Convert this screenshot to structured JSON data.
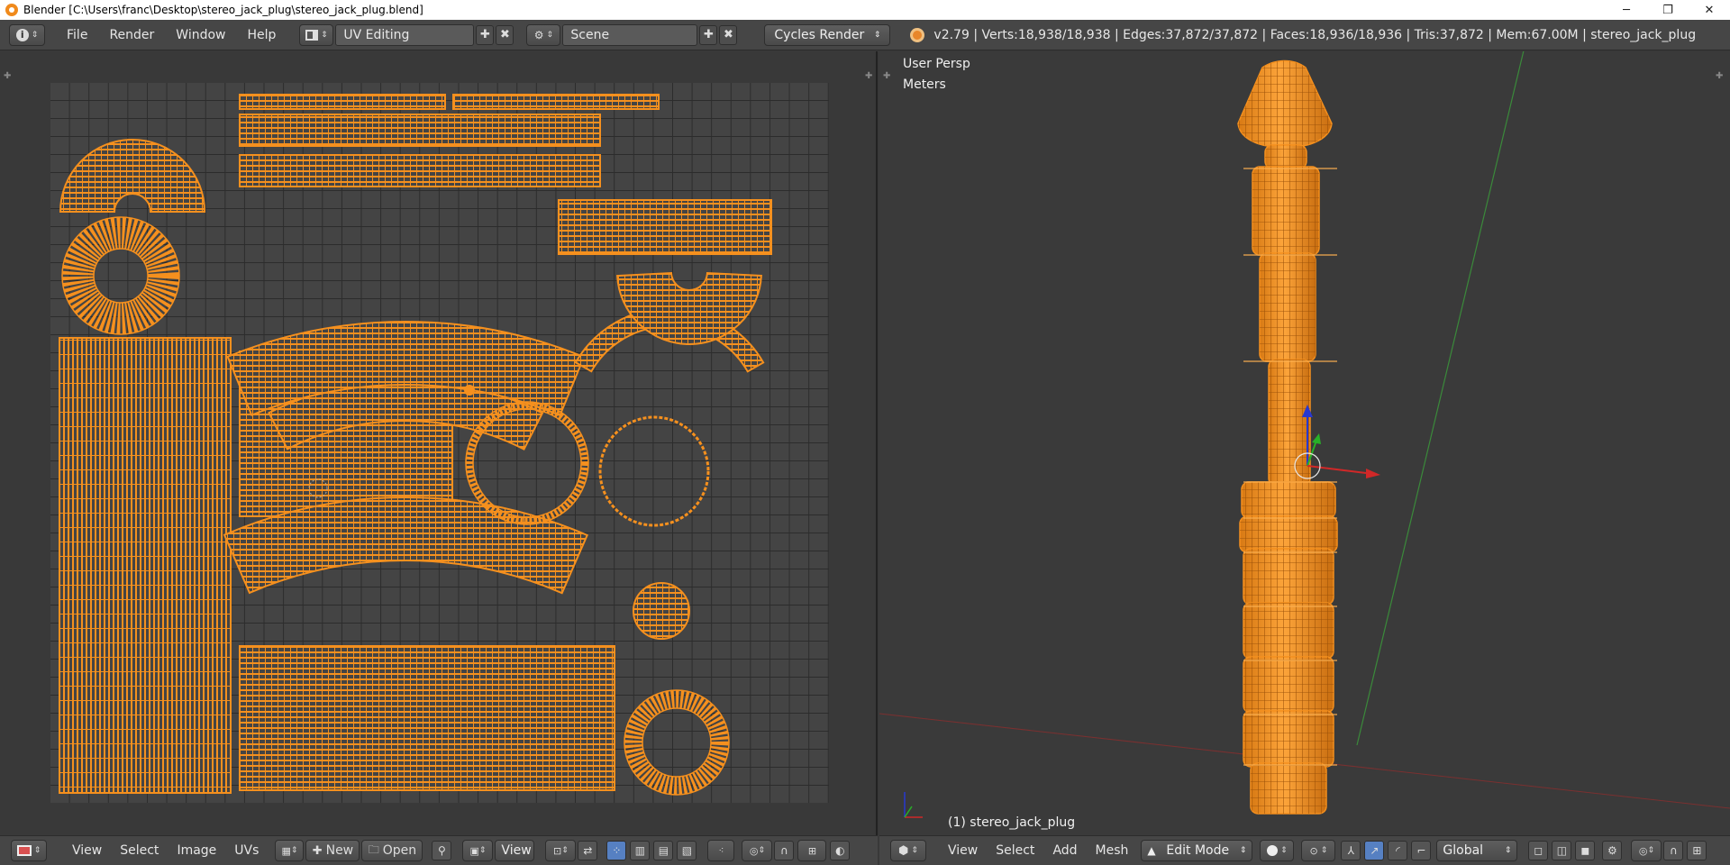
{
  "window": {
    "title": "Blender [C:\\Users\\franc\\Desktop\\stereo_jack_plug\\stereo_jack_plug.blend]",
    "minimize_glyph": "─",
    "restore_glyph": "❐",
    "close_glyph": "✕"
  },
  "info_header": {
    "menus": [
      "File",
      "Render",
      "Window",
      "Help"
    ],
    "screen_layout": "UV Editing",
    "scene": "Scene",
    "render_engine": "Cycles Render",
    "stats": "v2.79 | Verts:18,938/18,938 | Edges:37,872/37,872 | Faces:18,936/18,936 | Tris:37,872 | Mem:67.00M | stereo_jack_plug"
  },
  "viewport": {
    "view_name": "User Persp",
    "units": "Meters",
    "object_label": "(1) stereo_jack_plug"
  },
  "uv_header": {
    "menus": [
      "View",
      "Select",
      "Image",
      "UVs"
    ],
    "new_label": "New",
    "open_label": "Open",
    "view_label": "View"
  },
  "v3d_header": {
    "menus": [
      "View",
      "Select",
      "Add",
      "Mesh"
    ],
    "mode": "Edit Mode",
    "orientation": "Global"
  },
  "colors": {
    "mesh_select": "#f5901e",
    "background": "#393939",
    "header": "#464646",
    "axis_x": "#d02828",
    "axis_y": "#28b028",
    "axis_z": "#2838d0"
  }
}
